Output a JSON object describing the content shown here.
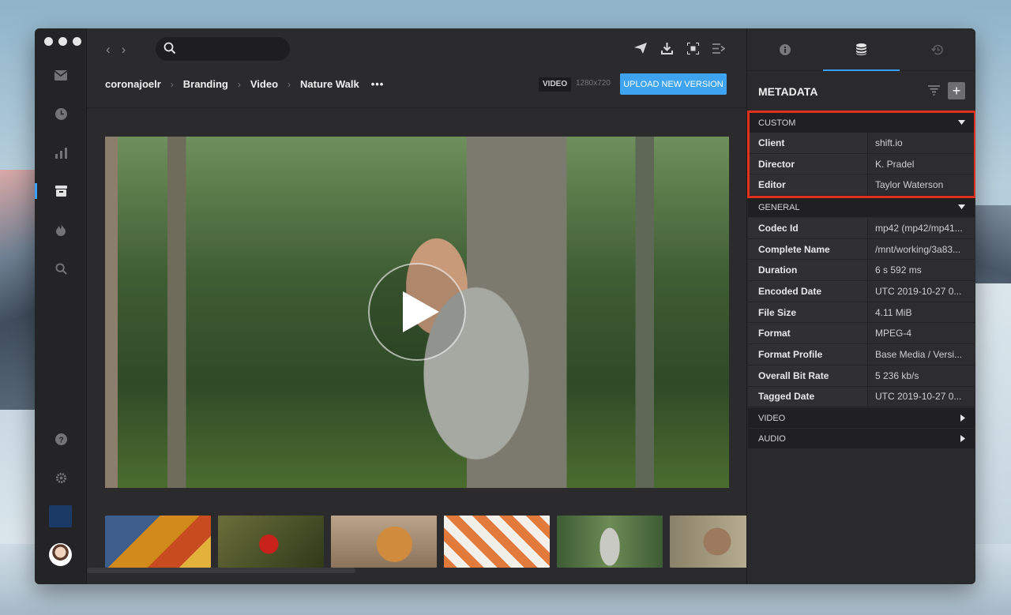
{
  "toolbar": {
    "nav_back": "‹",
    "nav_forward": "›",
    "search_placeholder": "",
    "icons": [
      "send-icon",
      "download-icon",
      "capture-icon",
      "queue-icon"
    ]
  },
  "breadcrumb": {
    "items": [
      "coronajoelr",
      "Branding",
      "Video",
      "Nature Walk"
    ],
    "more": "•••"
  },
  "asset": {
    "type_badge": "VIDEO",
    "resolution": "1280x720",
    "upload_label": "UPLOAD NEW VERSION"
  },
  "sidebar": {
    "icons": [
      "inbox-icon",
      "clock-icon",
      "chart-icon",
      "archive-icon",
      "fire-icon",
      "search-icon",
      "help-icon",
      "gear-icon"
    ],
    "active_index": 3
  },
  "panel": {
    "tabs": [
      "info-icon",
      "database-icon",
      "history-icon"
    ],
    "active_tab": 1,
    "title": "METADATA",
    "add_label": "+",
    "sections": {
      "custom": {
        "label": "CUSTOM",
        "rows": [
          {
            "key": "Client",
            "value": "shift.io"
          },
          {
            "key": "Director",
            "value": "K. Pradel"
          },
          {
            "key": "Editor",
            "value": "Taylor Waterson"
          }
        ]
      },
      "general": {
        "label": "GENERAL",
        "rows": [
          {
            "key": "Codec Id",
            "value": "mp42 (mp42/mp41..."
          },
          {
            "key": "Complete Name",
            "value": "/mnt/working/3a83..."
          },
          {
            "key": "Duration",
            "value": "6 s 592 ms"
          },
          {
            "key": "Encoded Date",
            "value": "UTC 2019-10-27 0..."
          },
          {
            "key": "File Size",
            "value": "4.11 MiB"
          },
          {
            "key": "Format",
            "value": "MPEG-4"
          },
          {
            "key": "Format Profile",
            "value": "Base Media / Versi..."
          },
          {
            "key": "Overall Bit Rate",
            "value": "5 236 kb/s"
          },
          {
            "key": "Tagged Date",
            "value": "UTC 2019-10-27 0..."
          }
        ]
      },
      "video": {
        "label": "VIDEO"
      },
      "audio": {
        "label": "AUDIO"
      }
    }
  },
  "colors": {
    "accent": "#3fa4ef",
    "highlight": "#e0301e"
  }
}
